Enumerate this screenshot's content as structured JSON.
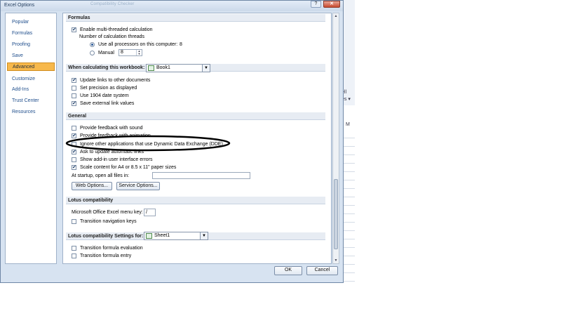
{
  "window": {
    "title": "Excel Options",
    "ghost_title": "Compatibility Checker",
    "help_icon": "?",
    "close_icon": "✕"
  },
  "nav": {
    "items": [
      {
        "label": "Popular"
      },
      {
        "label": "Formulas"
      },
      {
        "label": "Proofing"
      },
      {
        "label": "Save"
      },
      {
        "label": "Advanced",
        "active": true
      },
      {
        "label": "Customize"
      },
      {
        "label": "Add-Ins"
      },
      {
        "label": "Trust Center"
      },
      {
        "label": "Resources"
      }
    ]
  },
  "formulas": {
    "header": "Formulas",
    "multithread": {
      "label": "Enable multi-threaded calculation",
      "checked": true
    },
    "threads_label": "Number of calculation threads",
    "use_all": {
      "label": "Use all processors on this computer:",
      "value": "8",
      "selected": true
    },
    "manual": {
      "label": "Manual",
      "value": "8",
      "selected": false
    }
  },
  "workbook": {
    "header": "When calculating this workbook:",
    "selected": "Book1",
    "options": [
      {
        "label": "Update links to other documents",
        "checked": true
      },
      {
        "label": "Set precision as displayed",
        "checked": false
      },
      {
        "label": "Use 1904 date system",
        "checked": false
      },
      {
        "label": "Save external link values",
        "checked": true
      }
    ]
  },
  "general": {
    "header": "General",
    "options": [
      {
        "label": "Provide feedback with sound",
        "checked": false
      },
      {
        "label": "Provide feedback with animation",
        "checked": true
      },
      {
        "label": "Ignore other applications that use Dynamic Data Exchange (DDE)",
        "checked": false
      },
      {
        "label": "Ask to update automatic links",
        "checked": true
      },
      {
        "label": "Show add-in user interface errors",
        "checked": false
      },
      {
        "label": "Scale content for A4 or 8.5 x 11\" paper sizes",
        "checked": true
      }
    ],
    "startup_label": "At startup, open all files in:",
    "startup_value": "",
    "web_options": "Web Options...",
    "service_options": "Service Options..."
  },
  "lotus": {
    "header": "Lotus compatibility",
    "menu_key_label": "Microsoft Office Excel menu key:",
    "menu_key_value": "/",
    "nav_keys": {
      "label": "Transition navigation keys",
      "checked": false
    }
  },
  "lotus_settings": {
    "header": "Lotus compatibility Settings for:",
    "selected": "Sheet1",
    "options": [
      {
        "label": "Transition formula evaluation",
        "checked": false
      },
      {
        "label": "Transition formula entry",
        "checked": false
      }
    ]
  },
  "footer": {
    "ok": "OK",
    "cancel": "Cancel"
  },
  "background_app": {
    "text1": "ell",
    "text2": "es ▾",
    "text3": "M"
  }
}
